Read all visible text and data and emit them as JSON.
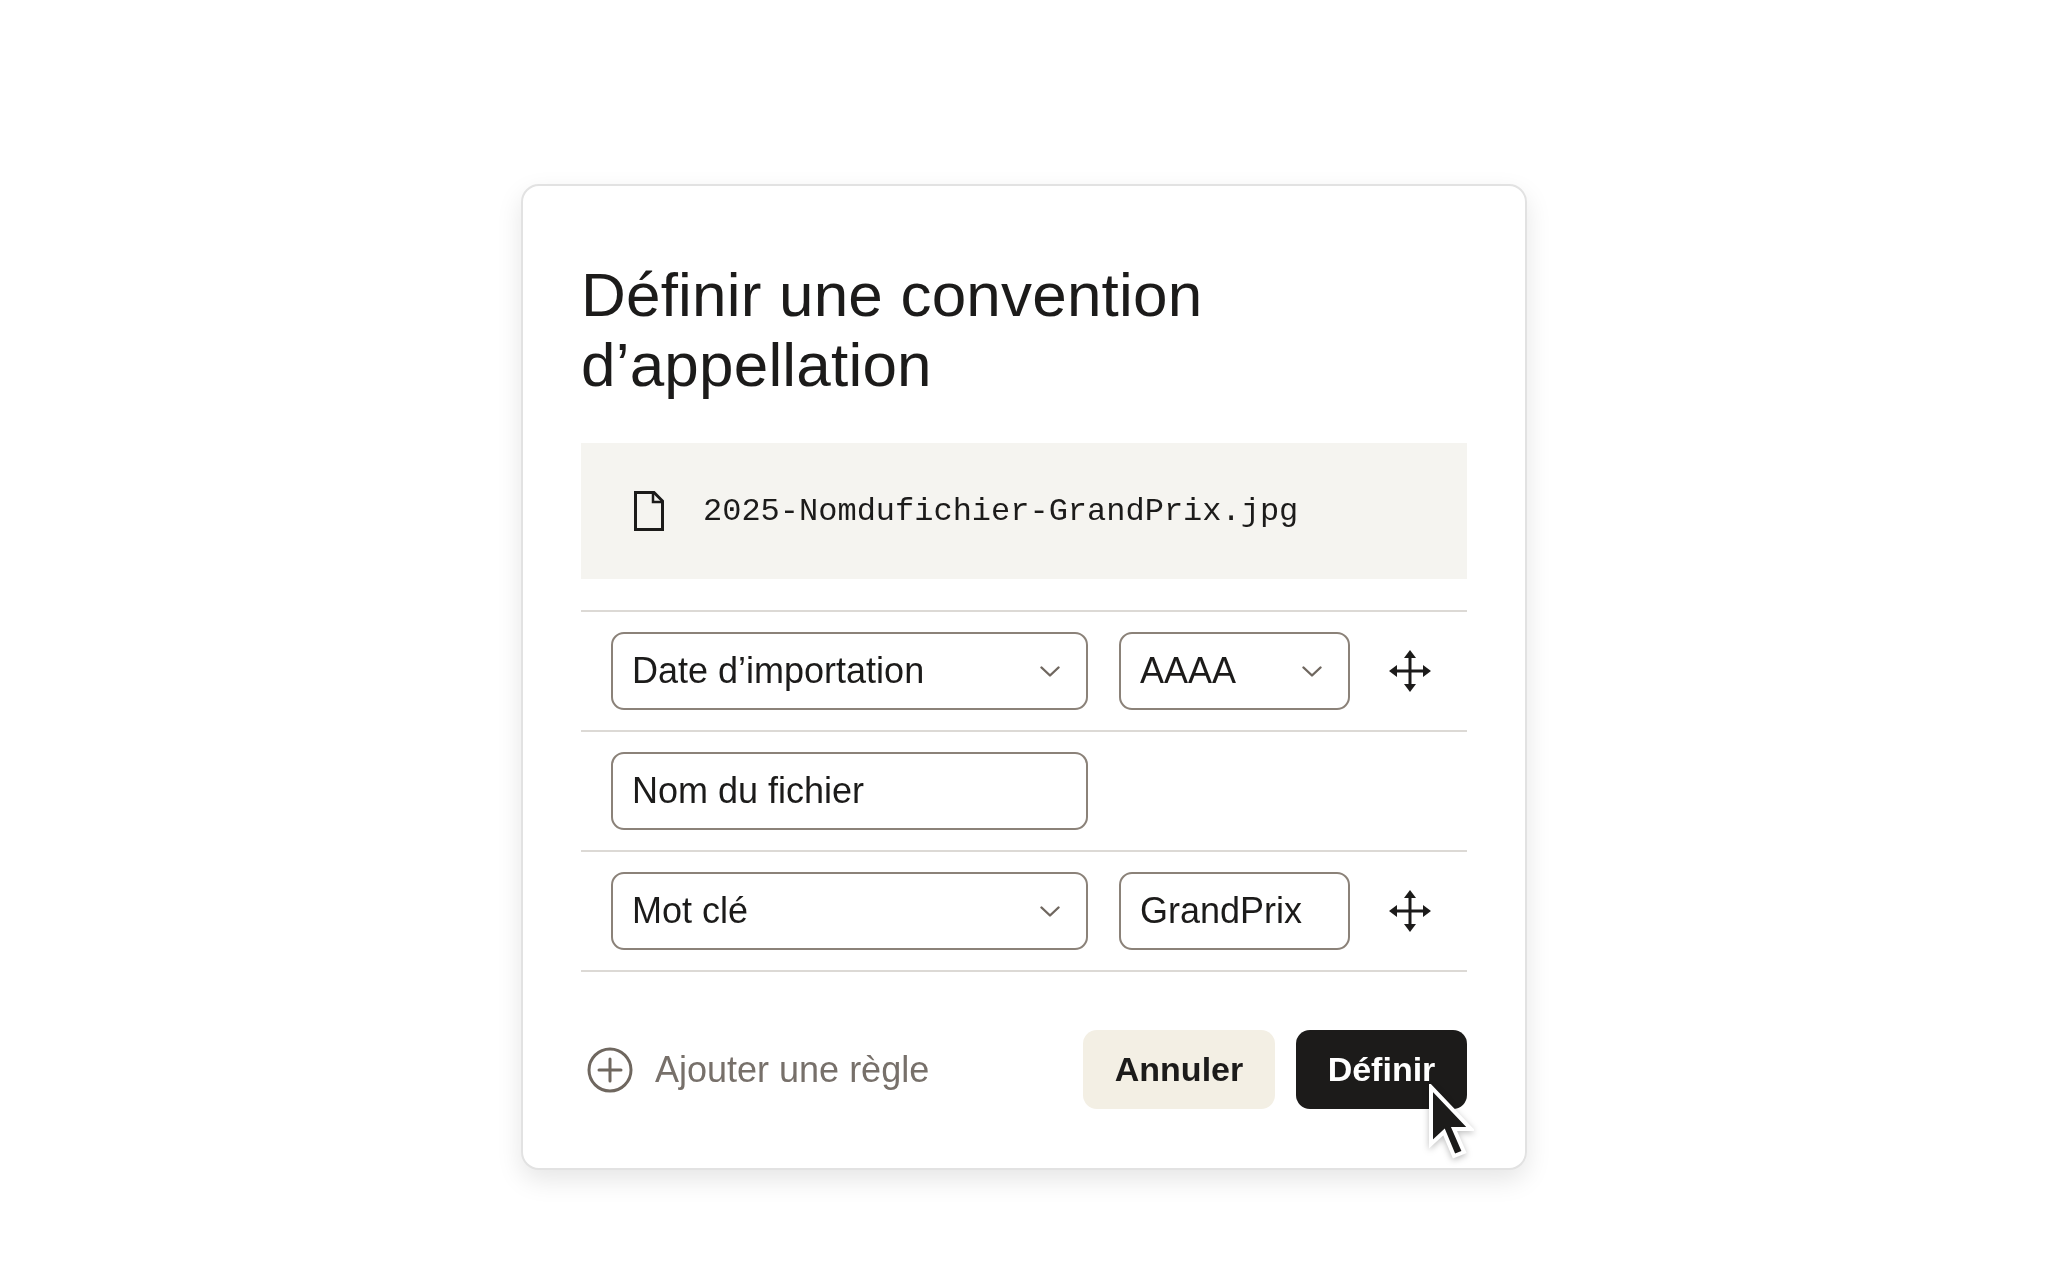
{
  "dialog": {
    "title": "Définir une convention d’appellation",
    "file_preview": {
      "filename": "2025-Nomdufichier-GrandPrix.jpg"
    },
    "rules": [
      {
        "field": {
          "kind": "dropdown",
          "value": "Date d’importation"
        },
        "option": {
          "kind": "dropdown",
          "value": "AAAA"
        },
        "draggable": true
      },
      {
        "field": {
          "kind": "text",
          "value": "Nom du fichier"
        },
        "draggable": false
      },
      {
        "field": {
          "kind": "dropdown",
          "value": "Mot clé"
        },
        "option": {
          "kind": "text",
          "value": "GrandPrix"
        },
        "draggable": true
      }
    ],
    "add_rule": {
      "label": "Ajouter une règle"
    },
    "buttons": [
      {
        "label": "Annuler",
        "kind": "secondary",
        "hovered": false
      },
      {
        "label": "Définir",
        "kind": "primary",
        "hovered": true
      }
    ]
  }
}
